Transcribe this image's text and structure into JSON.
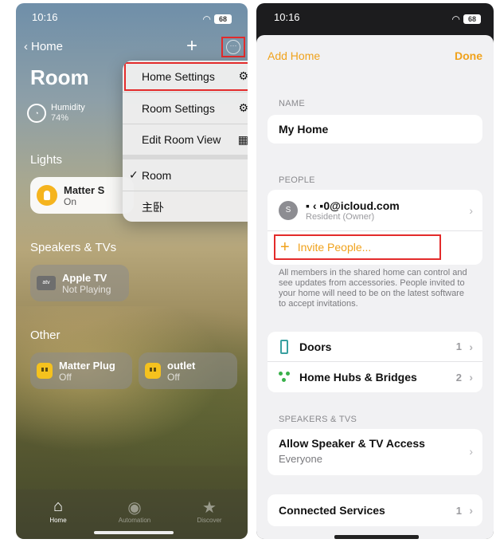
{
  "left": {
    "status": {
      "time": "10:16",
      "battery": "68"
    },
    "nav": {
      "back_label": "Home",
      "add": "+",
      "more": "···"
    },
    "title": "Room",
    "humidity": {
      "label": "Humidity",
      "value": "74%"
    },
    "sections": {
      "lights": "Lights",
      "speakers": "Speakers & TVs",
      "other": "Other"
    },
    "tiles": {
      "matter_light": {
        "name": "Matter S",
        "state": "On"
      },
      "apple_tv": {
        "name": "Apple TV",
        "state": "Not Playing",
        "badge": "atv"
      },
      "matter_plug": {
        "name": "Matter Plug",
        "state": "Off"
      },
      "outlet": {
        "name": "outlet",
        "state": "Off"
      }
    },
    "menu": {
      "home_settings": "Home Settings",
      "room_settings": "Room Settings",
      "edit_room_view": "Edit Room View",
      "room": "Room",
      "bedroom": "主卧",
      "check": "✓"
    },
    "tabs": [
      {
        "label": "Home",
        "icon": "⌂"
      },
      {
        "label": "Automation",
        "icon": "◉"
      },
      {
        "label": "Discover",
        "icon": "★"
      }
    ]
  },
  "right": {
    "status": {
      "time": "10:16",
      "battery": "68"
    },
    "nav": {
      "add_home": "Add Home",
      "done": "Done"
    },
    "name_header": "NAME",
    "home_name": "My Home",
    "people_header": "PEOPLE",
    "person": {
      "initial": "S",
      "email": "▪ ‹ ▪0@icloud.com",
      "role": "Resident (Owner)"
    },
    "invite": {
      "plus": "+",
      "label": "Invite People..."
    },
    "note": "All members in the shared home can control and see updates from accessories. People invited to your home will need to be on the latest software to accept invitations.",
    "rows": {
      "doors": {
        "label": "Doors",
        "count": "1"
      },
      "hubs": {
        "label": "Home Hubs & Bridges",
        "count": "2"
      }
    },
    "speakers_header": "SPEAKERS & TVS",
    "speaker_access": {
      "label": "Allow Speaker & TV Access",
      "value": "Everyone"
    },
    "connected": {
      "label": "Connected Services",
      "count": "1"
    }
  },
  "colors": {
    "accent": "#f0a21c",
    "highlight": "#e32b2b",
    "light_on": "#f5b41e",
    "plug": "#f5c21e"
  }
}
